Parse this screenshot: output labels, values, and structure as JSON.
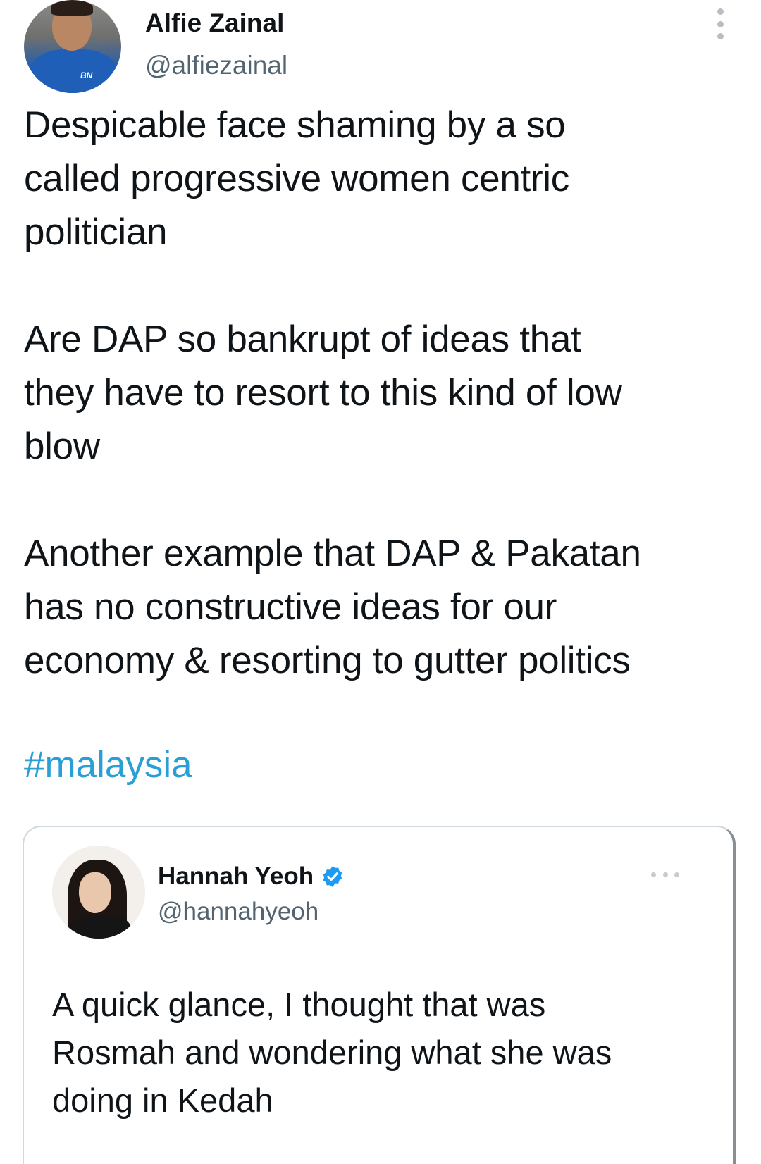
{
  "author": {
    "name": "Alfie Zainal",
    "handle": "@alfiezainal",
    "avatar_badge": "BN"
  },
  "tweet": {
    "lines": [
      "Despicable face shaming by a so",
      "called progressive women centric",
      "politician",
      "Are DAP so bankrupt of ideas that",
      "they have to resort to this kind of low",
      "blow",
      "Another example that DAP & Pakatan",
      "has no constructive ideas for our",
      "economy & resorting to gutter politics"
    ],
    "hashtag": "#malaysia"
  },
  "quoted_tweet": {
    "name": "Hannah Yeoh",
    "handle": "@hannahyeoh",
    "verified": true,
    "lines": [
      "A quick glance, I thought that was",
      "Rosmah and wondering what she was",
      "doing in Kedah"
    ]
  },
  "icons": {
    "more_main": "more-vertical-icon",
    "more_quote": "more-horizontal-icon",
    "verified": "verified-badge-icon"
  },
  "colors": {
    "hashtag": "#2a9fd6",
    "verified": "#1d9bf0",
    "secondary_text": "#536471"
  }
}
